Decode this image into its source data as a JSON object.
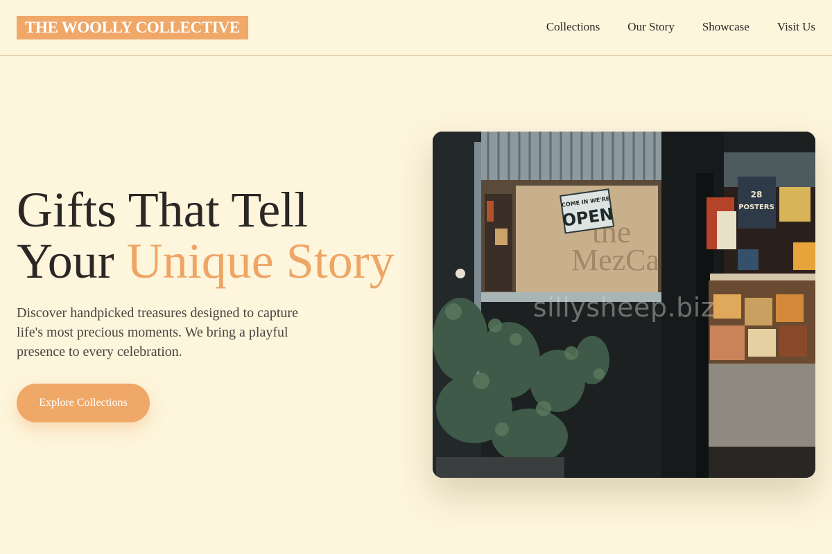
{
  "brand": {
    "name": "THE WOOLLY COLLECTIVE",
    "accent": "#f0a868",
    "background": "#fdf5dc"
  },
  "nav": {
    "items": [
      {
        "label": "Collections"
      },
      {
        "label": "Our Story"
      },
      {
        "label": "Showcase"
      },
      {
        "label": "Visit Us"
      }
    ]
  },
  "hero": {
    "title_line1": "Gifts That Tell",
    "title_line2_plain": "Your ",
    "title_line2_accent": "Unique Story",
    "description": "Discover handpicked treasures designed to capture life's most precious moments. We bring a playful presence to every celebration.",
    "cta_label": "Explore Collections"
  },
  "photo": {
    "watermark": "sillysheep.biz",
    "sign_text": "COME IN WE'RE OPEN",
    "poster_text": "28 POSTERS"
  }
}
